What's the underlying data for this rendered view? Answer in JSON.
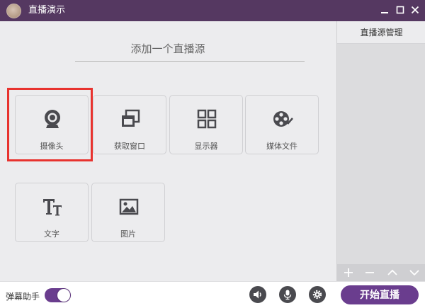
{
  "window": {
    "title": "直播演示",
    "controls": [
      "minimize-icon",
      "maximize-icon",
      "close-icon"
    ]
  },
  "main": {
    "add_source_title": "添加一个直播源",
    "sources": [
      {
        "label": "摄像头",
        "icon": "camera-icon",
        "selected": true
      },
      {
        "label": "获取窗口",
        "icon": "window-capture-icon"
      },
      {
        "label": "显示器",
        "icon": "display-grid-icon"
      },
      {
        "label": "媒体文件",
        "icon": "media-file-icon"
      },
      {
        "label": "文字",
        "icon": "text-icon"
      },
      {
        "label": "图片",
        "icon": "image-icon"
      }
    ]
  },
  "right_panel": {
    "title": "直播源管理",
    "toolbar": [
      "add-icon",
      "remove-icon",
      "move-up-icon",
      "move-down-icon"
    ]
  },
  "bottom": {
    "danmu_label": "弹幕助手",
    "danmu_enabled": true,
    "icons": [
      "speaker-icon",
      "microphone-icon",
      "settings-gear-icon"
    ],
    "start_label": "开始直播"
  },
  "colors": {
    "titlebar": "#553861",
    "accent": "#6a3d8e",
    "highlight": "#e8332f"
  }
}
